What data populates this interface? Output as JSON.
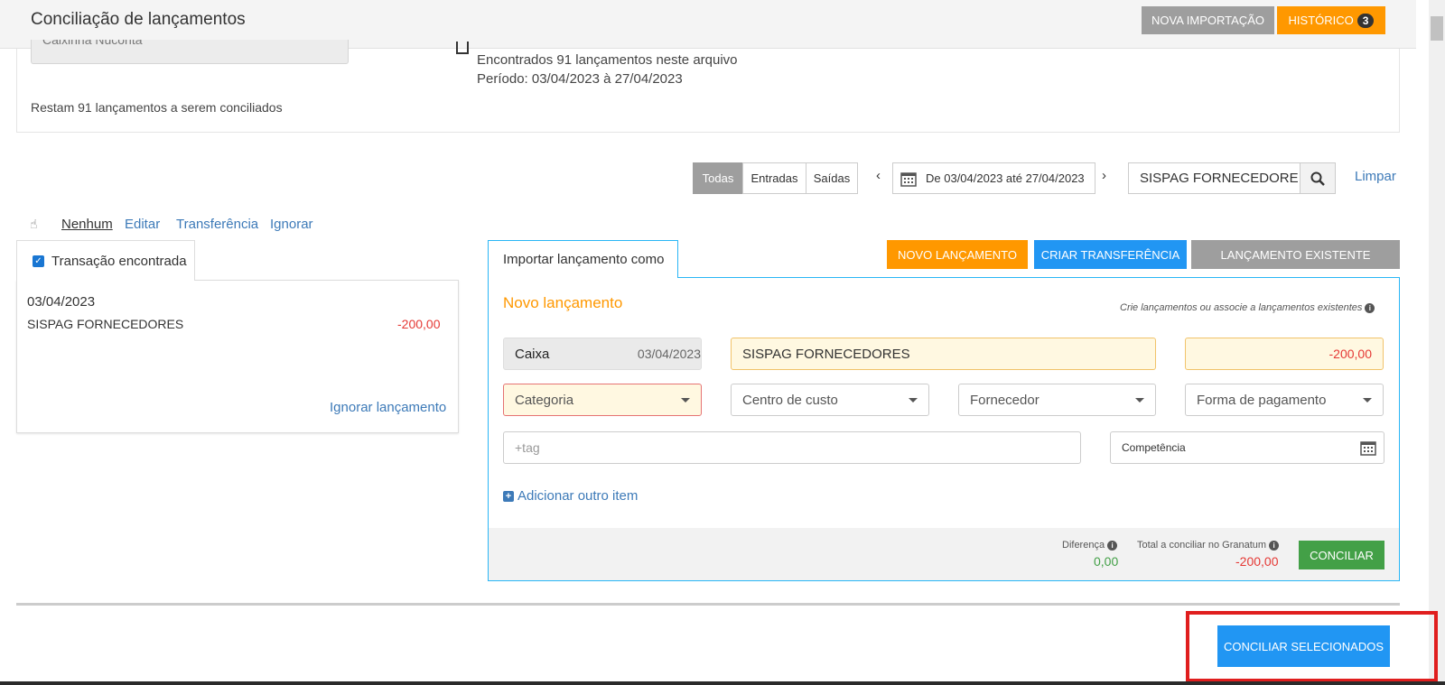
{
  "header": {
    "title": "Conciliação de lançamentos",
    "nova_importacao": "NOVA IMPORTAÇÃO",
    "historico": "HISTÓRICO",
    "historico_count": "3"
  },
  "summary": {
    "account": "Caixinha Nuconta",
    "found": "Encontrados 91 lançamentos neste arquivo",
    "period": "Período: 03/04/2023 à 27/04/2023",
    "remaining": "Restam 91 lançamentos a serem conciliados"
  },
  "filters": {
    "segments": [
      "Todas",
      "Entradas",
      "Saídas"
    ],
    "active_segment": "Todas",
    "date_range": "De 03/04/2023 até 27/04/2023",
    "search_value": "SISPAG FORNECEDORE",
    "clear": "Limpar"
  },
  "selection": {
    "nenhum": "Nenhum",
    "editar": "Editar",
    "transferencia": "Transferência",
    "ignorar": "Ignorar"
  },
  "transaction": {
    "tab_label": "Transação encontrada",
    "date": "03/04/2023",
    "description": "SISPAG FORNECEDORES",
    "amount": "-200,00",
    "ignore_link": "Ignorar lançamento"
  },
  "import": {
    "tab_label": "Importar lançamento como",
    "btn_novo": "NOVO LANÇAMENTO",
    "btn_criar": "CRIAR TRANSFERÊNCIA",
    "btn_existente": "LANÇAMENTO EXISTENTE",
    "title": "Novo lançamento",
    "hint": "Crie lançamentos ou associe a lançamentos existentes",
    "account": "Caixa",
    "date": "03/04/2023",
    "description": "SISPAG FORNECEDORES",
    "value": "-200,00",
    "categoria": "Categoria",
    "centro_custo": "Centro de custo",
    "fornecedor": "Fornecedor",
    "forma_pagamento": "Forma de pagamento",
    "tag_placeholder": "+tag",
    "competencia": "Competência",
    "add_item": "Adicionar outro item",
    "diferenca_label": "Diferença",
    "diferenca_value": "0,00",
    "total_label": "Total a conciliar no Granatum",
    "total_value": "-200,00",
    "conciliar": "CONCILIAR"
  },
  "bottom": {
    "conciliar_selecionados": "CONCILIAR SELECIONADOS"
  },
  "colors": {
    "orange": "#ff9800",
    "blue": "#2196f3",
    "green": "#43a047",
    "red": "#e53935",
    "highlight": "#e01e1e"
  }
}
